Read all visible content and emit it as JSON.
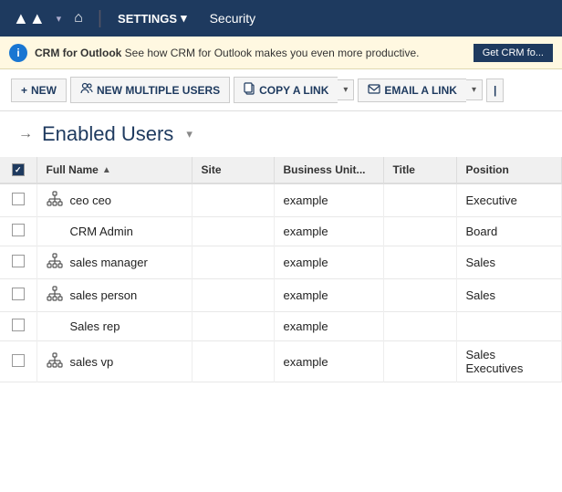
{
  "nav": {
    "logo": "▲▲",
    "home_icon": "⌂",
    "settings_label": "SETTINGS",
    "security_label": "Security",
    "chevron": "▾"
  },
  "banner": {
    "icon": "i",
    "app_name": "CRM for Outlook",
    "message": "See how CRM for Outlook makes you even more productive.",
    "button_label": "Get CRM fo..."
  },
  "toolbar": {
    "new_label": "NEW",
    "new_multiple_label": "NEW MULTIPLE USERS",
    "copy_link_label": "COPY A LINK",
    "email_link_label": "EMAIL A LINK",
    "new_icon": "+",
    "users_icon": "👥",
    "copy_icon": "📄",
    "email_icon": "✉"
  },
  "page": {
    "pin_icon": "→",
    "title": "Enabled Users",
    "title_chevron": "▾"
  },
  "table": {
    "columns": [
      {
        "key": "check",
        "label": ""
      },
      {
        "key": "fullname",
        "label": "Full Name",
        "sortable": true,
        "sort_dir": "asc"
      },
      {
        "key": "site",
        "label": "Site"
      },
      {
        "key": "businessunit",
        "label": "Business Unit..."
      },
      {
        "key": "title",
        "label": "Title"
      },
      {
        "key": "position",
        "label": "Position"
      }
    ],
    "rows": [
      {
        "has_icon": true,
        "fullname": "ceo ceo",
        "site": "",
        "businessunit": "example",
        "title": "",
        "position": "Executive"
      },
      {
        "has_icon": false,
        "fullname": "CRM Admin",
        "site": "",
        "businessunit": "example",
        "title": "",
        "position": "Board"
      },
      {
        "has_icon": true,
        "fullname": "sales manager",
        "site": "",
        "businessunit": "example",
        "title": "",
        "position": "Sales"
      },
      {
        "has_icon": true,
        "fullname": "sales person",
        "site": "",
        "businessunit": "example",
        "title": "",
        "position": "Sales"
      },
      {
        "has_icon": false,
        "fullname": "Sales rep",
        "site": "",
        "businessunit": "example",
        "title": "",
        "position": ""
      },
      {
        "has_icon": true,
        "fullname": "sales vp",
        "site": "",
        "businessunit": "example",
        "title": "",
        "position": "Sales Executives"
      }
    ]
  }
}
